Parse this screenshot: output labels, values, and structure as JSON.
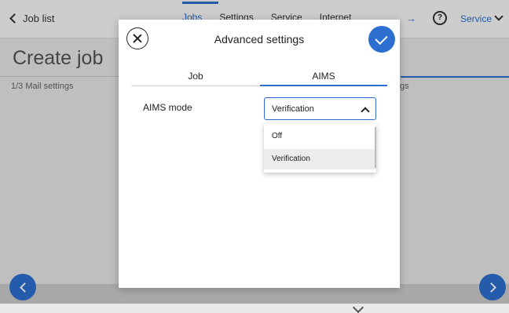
{
  "app": {
    "back_label": "Job list",
    "nav_tabs": [
      "Jobs",
      "Settings",
      "Service",
      "Internet"
    ],
    "service_label": "Service",
    "page_title": "Create job",
    "step": "1/3 Mail settings",
    "right_hint": "gs"
  },
  "icons": {
    "back": "chevron-left-icon",
    "wifi": "wifi-icon",
    "help": "help-icon",
    "dropdown": "chevron-down-icon",
    "close": "close-icon",
    "confirm": "check-icon",
    "select": "chevron-up-icon"
  },
  "dialog": {
    "title": "Advanced settings",
    "tabs": [
      "Job",
      "AIMS"
    ],
    "active_tab": "AIMS",
    "field_label": "AIMS mode",
    "selected_value": "Verification",
    "options": [
      "Off",
      "Verification"
    ]
  },
  "colors": {
    "accent": "#2c6fd1",
    "background": "#e9e9e9"
  }
}
